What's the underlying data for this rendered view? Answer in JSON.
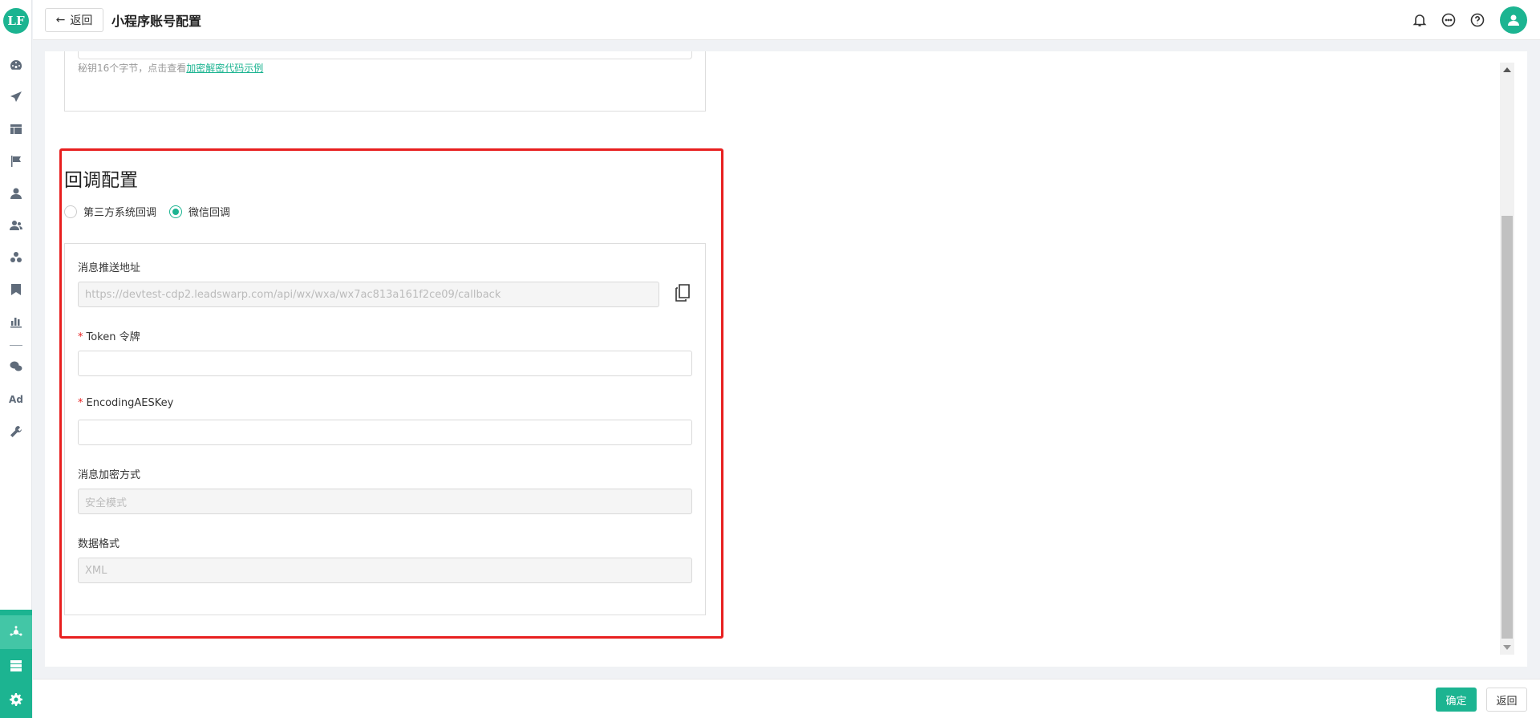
{
  "app": {
    "logo_text": "LF"
  },
  "header": {
    "back_label": "返回",
    "title": "小程序账号配置",
    "icons": [
      "bell-icon",
      "chat-icon",
      "help-icon",
      "user-avatar-icon"
    ]
  },
  "sidebar": {
    "items": [
      "dashboard-icon",
      "send-icon",
      "layout-icon",
      "flag-icon",
      "user-icon",
      "users-icon",
      "groups-icon",
      "bookmark-icon",
      "bar-chart-icon",
      "wechat-icon",
      "ad-icon",
      "wrench-icon"
    ],
    "ad_label": "Ad",
    "bottom_items": [
      "network-icon",
      "server-icon",
      "gear-icon"
    ]
  },
  "previous_section": {
    "hint_text": "秘钥16个字节，点击查看",
    "hint_link": "加密解密代码示例"
  },
  "callback": {
    "section_title": "回调配置",
    "radio_options": [
      {
        "label": "第三方系统回调",
        "checked": false
      },
      {
        "label": "微信回调",
        "checked": true
      }
    ],
    "fields": {
      "push_url": {
        "label": "消息推送地址",
        "value": "https://devtest-cdp2.leadswarp.com/api/wx/wxa/wx7ac813a161f2ce09/callback"
      },
      "token": {
        "label": "Token 令牌",
        "required_mark": "*",
        "value": ""
      },
      "aeskey": {
        "label": "EncodingAESKey",
        "required_mark": "*",
        "value": ""
      },
      "encrypt_mode": {
        "label": "消息加密方式",
        "value": "安全模式"
      },
      "data_format": {
        "label": "数据格式",
        "value": "XML"
      }
    }
  },
  "footer": {
    "confirm_label": "确定",
    "back_label": "返回"
  },
  "colors": {
    "accent": "#1cb491",
    "highlight_border": "#e81f1f"
  }
}
